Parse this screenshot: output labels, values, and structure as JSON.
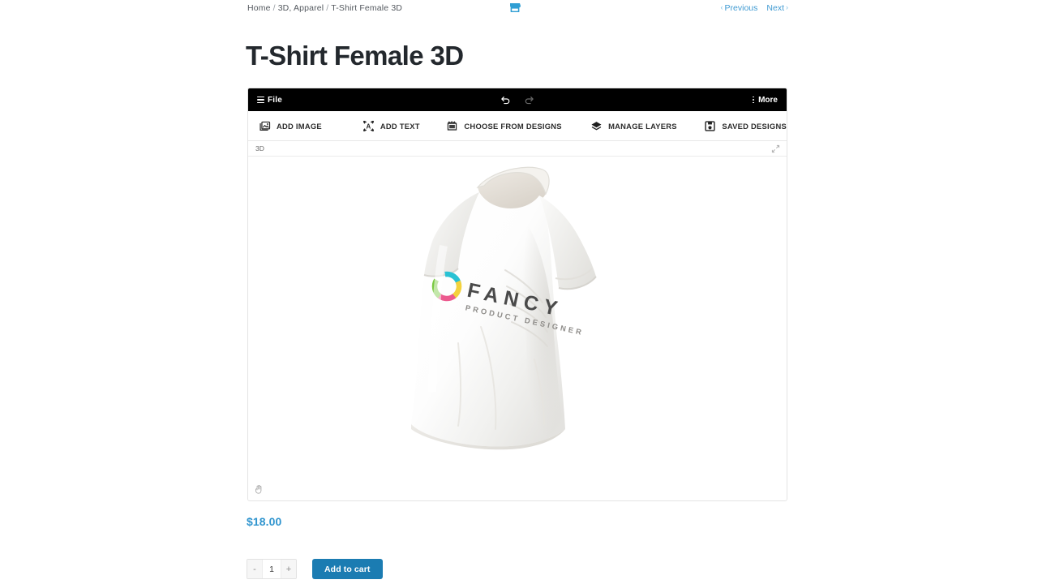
{
  "breadcrumb": {
    "items": [
      "Home",
      "3D, Apparel",
      "T-Shirt Female 3D"
    ],
    "separator": "/"
  },
  "topbar": {
    "store_icon": "store-icon",
    "previous_label": "Previous",
    "next_label": "Next",
    "prev_chevron": "‹",
    "next_chevron": "›",
    "link_color": "#3f9ad2"
  },
  "product": {
    "title": "T-Shirt Female 3D",
    "price": "$18.00",
    "quantity": "1",
    "qty_minus": "-",
    "qty_plus": "+",
    "add_to_cart_label": "Add to cart",
    "add_to_cart_color": "#1b7cb2",
    "price_color": "#2f94ce"
  },
  "designer": {
    "header": {
      "file_label": "File",
      "menu_icon": "hamburger-icon",
      "undo_icon": "undo-icon",
      "redo_icon": "redo-icon",
      "more_label": "More",
      "more_icon": "vertical-dots-icon",
      "background": "#000000"
    },
    "tools": [
      {
        "label": "ADD IMAGE",
        "icon": "image-icon"
      },
      {
        "label": "ADD TEXT",
        "icon": "text-box-icon"
      },
      {
        "label": "CHOOSE FROM DESIGNS",
        "icon": "designs-icon"
      },
      {
        "label": "MANAGE LAYERS",
        "icon": "layers-icon"
      },
      {
        "label": "SAVED DESIGNS",
        "icon": "floppy-disk-icon"
      }
    ],
    "view": {
      "tab_label": "3D",
      "expand_icon": "expand-arrows-icon"
    },
    "stage": {
      "rotate_hint_icon": "hand-cursor-icon",
      "product_name": "T-Shirt Female 3D",
      "shirt_color": "#ffffff",
      "print": {
        "title": "FANCY",
        "subtitle": "PRODUCT DESIGNER",
        "logo_icon": "color-ring-logo",
        "logo_colors": [
          "#29c2d4",
          "#f4d23c",
          "#ec5a8e",
          "#7ac943"
        ]
      }
    }
  }
}
